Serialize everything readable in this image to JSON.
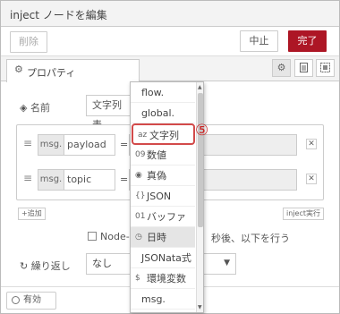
{
  "window": {
    "title": "inject ノードを編集"
  },
  "toolbar": {
    "delete_label": "削除",
    "cancel_label": "中止",
    "done_label": "完了",
    "done_color": "#ad1625"
  },
  "tabs": {
    "properties_label": "プロパティ"
  },
  "form": {
    "name_label": "名前",
    "name_value": "文字列表",
    "properties": [
      {
        "prefix": "msg.",
        "key": "payload"
      },
      {
        "prefix": "msg.",
        "key": "topic"
      }
    ],
    "eq": "=",
    "add_label": "+追加",
    "inject_now_label": "inject実行",
    "once_label": "Node-R",
    "once_suffix": "秒後、以下を行う",
    "repeat_label": "繰り返し",
    "repeat_value": "なし"
  },
  "footer": {
    "enabled_label": "有効"
  },
  "dropdown": {
    "items": [
      {
        "icon": "",
        "label": "flow."
      },
      {
        "icon": "",
        "label": "global."
      },
      {
        "icon": "az",
        "label": "文字列"
      },
      {
        "icon": "09",
        "label": "数値"
      },
      {
        "icon": "◉",
        "label": "真偽"
      },
      {
        "icon": "{}",
        "label": "JSON"
      },
      {
        "icon": "01",
        "label": "バッファ"
      },
      {
        "icon": "◷",
        "label": "日時"
      },
      {
        "icon": "",
        "label": "JSONata式"
      },
      {
        "icon": "$",
        "label": "環境変数"
      },
      {
        "icon": "",
        "label": "msg."
      }
    ],
    "selected_color": "#d24a4a"
  },
  "annotation": {
    "marker": "⑤",
    "color": "#cc2222"
  }
}
